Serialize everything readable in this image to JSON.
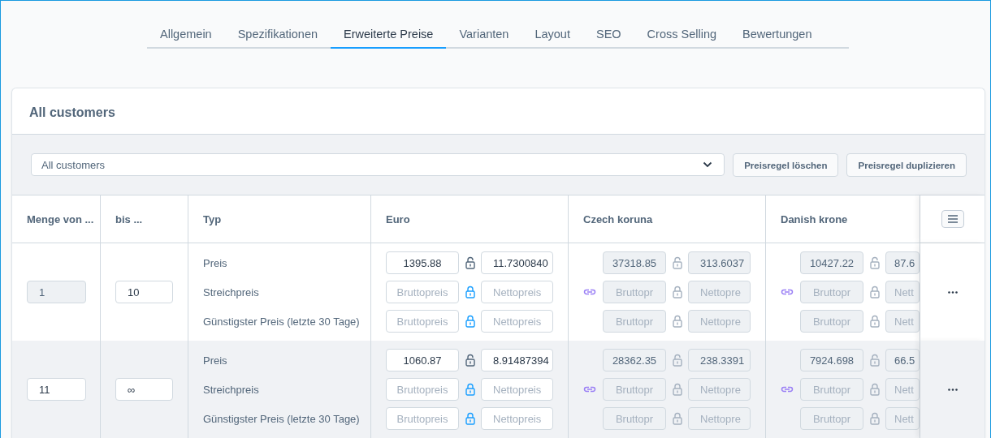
{
  "tabs": [
    {
      "label": "Allgemein",
      "selected": false
    },
    {
      "label": "Spezifikationen",
      "selected": false
    },
    {
      "label": "Erweiterte Preise",
      "selected": true
    },
    {
      "label": "Varianten",
      "selected": false
    },
    {
      "label": "Layout",
      "selected": false
    },
    {
      "label": "SEO",
      "selected": false
    },
    {
      "label": "Cross Selling",
      "selected": false
    },
    {
      "label": "Bewertungen",
      "selected": false
    }
  ],
  "card": {
    "title": "All customers",
    "rule_select": {
      "value": "All customers"
    },
    "buttons": [
      "Preisregel löschen",
      "Preisregel duplizieren"
    ],
    "table": {
      "columns": [
        "Menge von ...",
        "bis ...",
        "Typ",
        "Euro",
        "Czech koruna",
        "Danish krone"
      ],
      "rows": [
        {
          "highlighted": false,
          "from": {
            "value": "1",
            "disabled": true
          },
          "to": {
            "value": "10",
            "disabled": false
          },
          "types": [
            "Preis",
            "Streichpreis",
            "Günstigster Preis (letzte 30 Tage)"
          ],
          "currencies": [
            {
              "inherited": false,
              "cells": [
                {
                  "gross": {
                    "value": "1395.88"
                  },
                  "locked": false,
                  "net": {
                    "value": "11.7300840"
                  }
                },
                {
                  "gross": {
                    "placeholder": "Bruttopreis"
                  },
                  "locked": true,
                  "net": {
                    "placeholder": "Nettopreis"
                  }
                },
                {
                  "gross": {
                    "placeholder": "Bruttopreis"
                  },
                  "locked": true,
                  "net": {
                    "placeholder": "Nettopreis"
                  }
                }
              ]
            },
            {
              "inherited": true,
              "cells": [
                {
                  "gross": {
                    "value": "37318.85"
                  },
                  "locked": false,
                  "net": {
                    "value": "313.6037"
                  }
                },
                {
                  "gross": {
                    "placeholder": "Bruttopr"
                  },
                  "locked": true,
                  "net": {
                    "placeholder": "Nettopre"
                  }
                },
                {
                  "gross": {
                    "placeholder": "Bruttopr"
                  },
                  "locked": true,
                  "net": {
                    "placeholder": "Nettopre"
                  }
                }
              ]
            },
            {
              "inherited": true,
              "cells": [
                {
                  "gross": {
                    "value": "10427.22"
                  },
                  "locked": false,
                  "net": {
                    "value": "87.6"
                  }
                },
                {
                  "gross": {
                    "placeholder": "Bruttopr"
                  },
                  "locked": true,
                  "net": {
                    "placeholder": "Nett"
                  }
                },
                {
                  "gross": {
                    "placeholder": "Bruttopr"
                  },
                  "locked": true,
                  "net": {
                    "placeholder": "Nett"
                  }
                }
              ]
            }
          ]
        },
        {
          "highlighted": true,
          "from": {
            "value": "11",
            "disabled": false
          },
          "to": {
            "value": "∞",
            "disabled": false
          },
          "types": [
            "Preis",
            "Streichpreis",
            "Günstigster Preis (letzte 30 Tage)"
          ],
          "currencies": [
            {
              "inherited": false,
              "cells": [
                {
                  "gross": {
                    "value": "1060.87"
                  },
                  "locked": false,
                  "net": {
                    "value": "8.91487394"
                  }
                },
                {
                  "gross": {
                    "placeholder": "Bruttopreis"
                  },
                  "locked": true,
                  "net": {
                    "placeholder": "Nettopreis"
                  }
                },
                {
                  "gross": {
                    "placeholder": "Bruttopreis"
                  },
                  "locked": true,
                  "net": {
                    "placeholder": "Nettopreis"
                  }
                }
              ]
            },
            {
              "inherited": true,
              "cells": [
                {
                  "gross": {
                    "value": "28362.35"
                  },
                  "locked": false,
                  "net": {
                    "value": "238.3391"
                  }
                },
                {
                  "gross": {
                    "placeholder": "Bruttopr"
                  },
                  "locked": true,
                  "net": {
                    "placeholder": "Nettopre"
                  }
                },
                {
                  "gross": {
                    "placeholder": "Bruttopr"
                  },
                  "locked": true,
                  "net": {
                    "placeholder": "Nettopre"
                  }
                }
              ]
            },
            {
              "inherited": true,
              "cells": [
                {
                  "gross": {
                    "value": "7924.698"
                  },
                  "locked": false,
                  "net": {
                    "value": "66.5"
                  }
                },
                {
                  "gross": {
                    "placeholder": "Bruttopr"
                  },
                  "locked": true,
                  "net": {
                    "placeholder": "Nett"
                  }
                },
                {
                  "gross": {
                    "placeholder": "Bruttopr"
                  },
                  "locked": true,
                  "net": {
                    "placeholder": "Nett"
                  }
                }
              ]
            }
          ]
        }
      ]
    }
  }
}
